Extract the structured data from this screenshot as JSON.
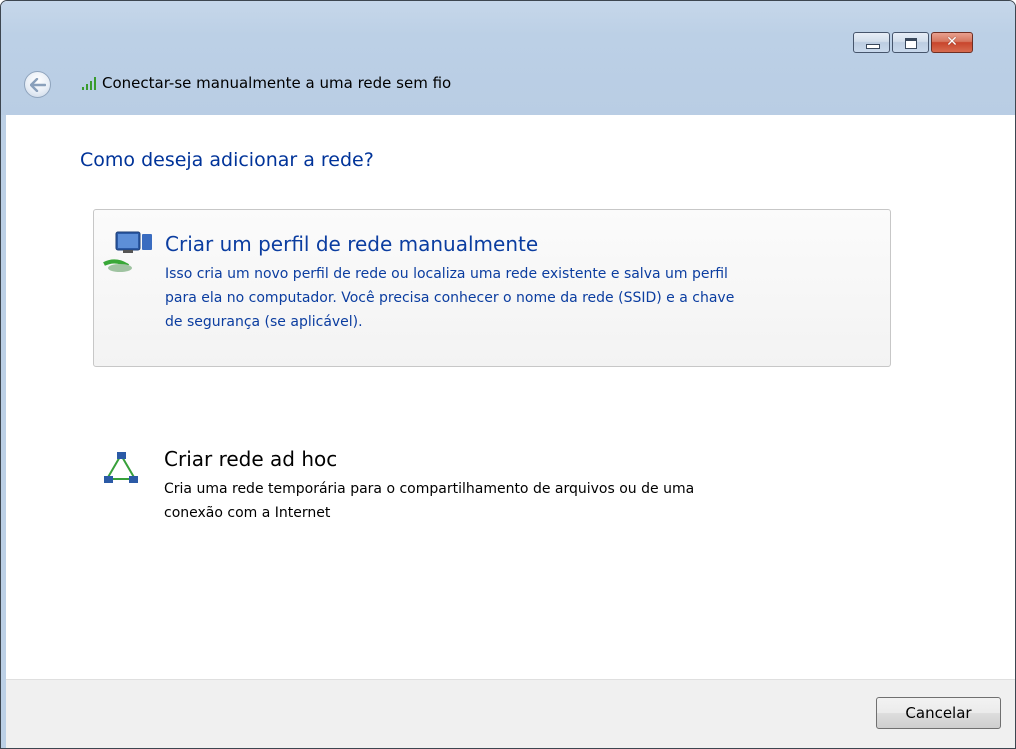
{
  "window": {
    "title": "Conectar-se manualmente a uma rede sem fio",
    "controls": {
      "minimize": "minimize",
      "maximize": "maximize",
      "close": "close"
    }
  },
  "main": {
    "heading": "Como deseja adicionar a rede?",
    "options": [
      {
        "title": "Criar um perfil de rede manualmente",
        "description_lines": [
          "Isso cria um novo perfil de rede ou localiza uma rede existente e salva um perfil",
          "para ela no computador. Você precisa conhecer o nome da rede (SSID) e a chave",
          "de segurança (se aplicável)."
        ],
        "icon": "network-computer-icon"
      },
      {
        "title": "Criar rede ad hoc",
        "description_lines": [
          "Cria uma rede temporária para o compartilhamento de arquivos ou de uma",
          "conexão com a Internet"
        ],
        "icon": "adhoc-network-icon"
      }
    ]
  },
  "footer": {
    "cancel_label": "Cancelar"
  },
  "colors": {
    "accent": "#003399",
    "link": "#0b3da0",
    "frame": "#bcd0e6",
    "footer_bg": "#f0f0f0"
  }
}
